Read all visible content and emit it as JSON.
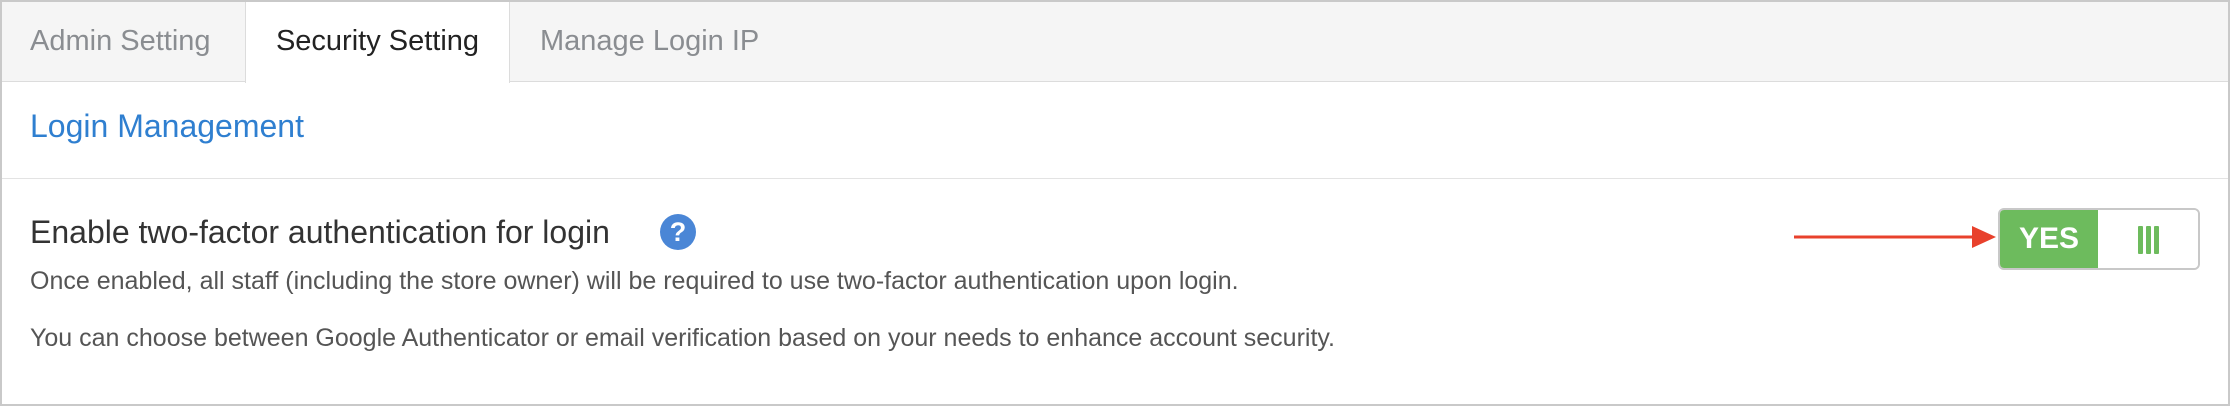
{
  "tabs": [
    {
      "label": "Admin Setting",
      "active": false
    },
    {
      "label": "Security Setting",
      "active": true
    },
    {
      "label": "Manage Login IP",
      "active": false
    }
  ],
  "section": {
    "title": "Login Management"
  },
  "setting": {
    "title": "Enable two-factor authentication for login",
    "help_icon": "question-circle-icon",
    "description_1": "Once enabled, all staff (including the store owner) will be required to use two-factor authentication upon login.",
    "description_2": "You can choose between Google Authenticator or email verification based on your needs to enhance account security.",
    "toggle": {
      "label": "YES",
      "state": "on",
      "handle_icon": "grip-lines-icon"
    }
  },
  "annotation": {
    "icon": "red-arrow-icon"
  },
  "colors": {
    "link_blue": "#2f7fd0",
    "toggle_green": "#6dbb5d",
    "help_blue": "#4a86d6",
    "annotation_red": "#e8412c"
  }
}
